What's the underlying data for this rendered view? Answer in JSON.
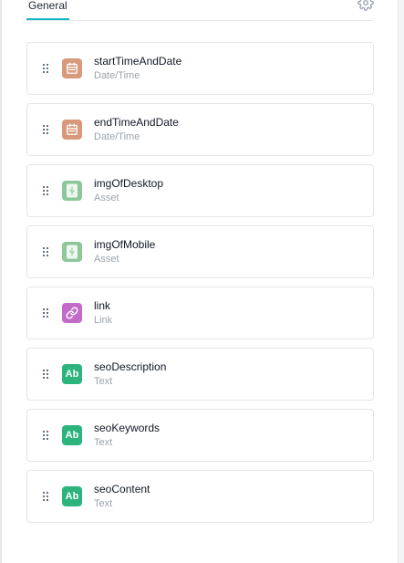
{
  "tabs": [
    {
      "label": "General",
      "active": true
    }
  ],
  "settings_icon": "gear-icon",
  "accent_color": "#14b8c4",
  "fields": [
    {
      "name": "startTimeAndDate",
      "type": "Date/Time",
      "icon": "calendar-icon",
      "color": "#d99a7c"
    },
    {
      "name": "endTimeAndDate",
      "type": "Date/Time",
      "icon": "calendar-icon",
      "color": "#d99a7c"
    },
    {
      "name": "imgOfDesktop",
      "type": "Asset",
      "icon": "asset-icon",
      "color": "#8ec79a"
    },
    {
      "name": "imgOfMobile",
      "type": "Asset",
      "icon": "asset-icon",
      "color": "#8ec79a"
    },
    {
      "name": "link",
      "type": "Link",
      "icon": "link-icon",
      "color": "#c26bc8"
    },
    {
      "name": "seoDescription",
      "type": "Text",
      "icon": "text-icon",
      "icon_text": "Ab",
      "color": "#2db47d"
    },
    {
      "name": "seoKeywords",
      "type": "Text",
      "icon": "text-icon",
      "icon_text": "Ab",
      "color": "#2db47d"
    },
    {
      "name": "seoContent",
      "type": "Text",
      "icon": "text-icon",
      "icon_text": "Ab",
      "color": "#2db47d"
    }
  ]
}
